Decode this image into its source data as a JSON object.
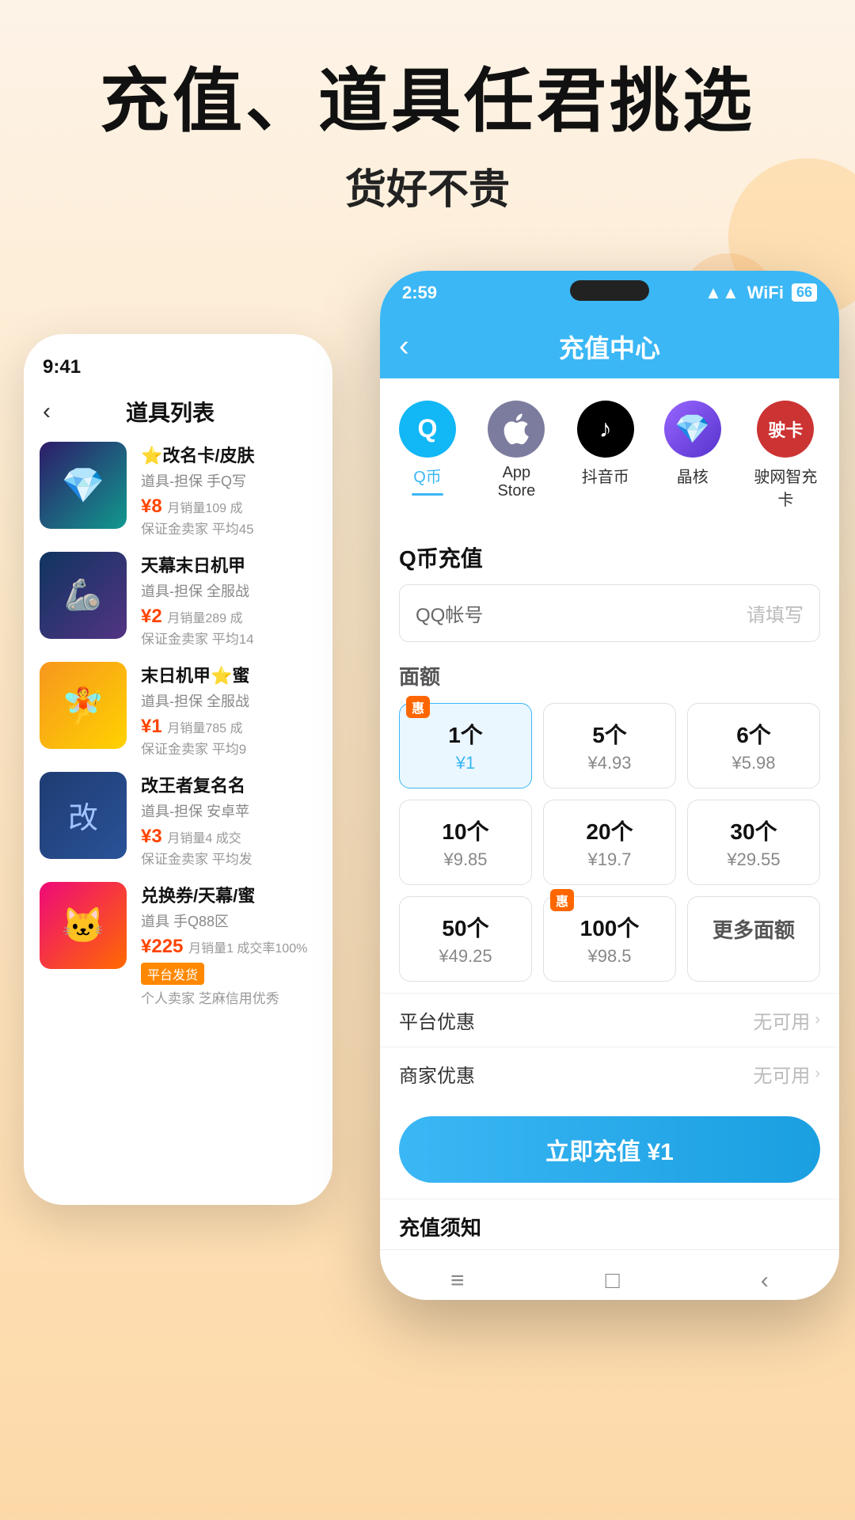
{
  "hero": {
    "title": "充值、道具任君挑选",
    "subtitle": "货好不贵"
  },
  "back_phone": {
    "status_time": "9:41",
    "nav_back": "‹",
    "nav_title": "道具列表",
    "items": [
      {
        "name": "⭐改名卡/皮肤",
        "desc": "道具-担保 手Q写",
        "price": "¥8",
        "sales": "月销量109 成",
        "seller": "保证金卖家 平均45",
        "color": "crystal",
        "emoji": "💎"
      },
      {
        "name": "天幕末日机甲",
        "desc": "道具-担保 全服战",
        "price": "¥2",
        "sales": "月销量289 成",
        "seller": "保证金卖家 平均14",
        "color": "robot",
        "emoji": "🤖"
      },
      {
        "name": "末日机甲⭐蜜",
        "desc": "道具-担保 全服战",
        "price": "¥1",
        "sales": "月销量785 成",
        "seller": "保证金卖家 平均9",
        "color": "angel",
        "emoji": "👼"
      },
      {
        "name": "改王者复名名",
        "desc": "道具-担保 安卓苹",
        "price": "¥3",
        "sales": "月销量4 成交",
        "seller": "保证金卖家 平均发",
        "color": "card",
        "emoji": "🃏"
      },
      {
        "name": "兑换券/天幕/蜜",
        "desc": "道具 手Q88区",
        "price": "¥225",
        "sales": "月销量1 成交率100%",
        "seller": "平台发货",
        "platform": true,
        "seller2": "个人卖家 芝麻信用优秀",
        "color": "kitty",
        "emoji": "🐱"
      }
    ]
  },
  "front_phone": {
    "status_time": "2:59",
    "status_icons": "▲▲ WiFi 66",
    "nav_back": "‹",
    "nav_title": "充值中心",
    "categories": [
      {
        "label": "Q币",
        "icon": "Q",
        "active": true
      },
      {
        "label": "App Store",
        "icon": "🍎",
        "active": false
      },
      {
        "label": "抖音币",
        "icon": "♪",
        "active": false
      },
      {
        "label": "晶核",
        "icon": "💜",
        "active": false
      },
      {
        "label": "驶卡",
        "icon": "驶",
        "active": false
      }
    ],
    "section_title": "Q币充值",
    "account_label": "QQ帐号",
    "account_placeholder": "请填写",
    "denom_title": "面额",
    "denominations": [
      {
        "qty": "1个",
        "price": "¥1",
        "selected": true,
        "badge": "惠"
      },
      {
        "qty": "5个",
        "price": "¥4.93",
        "selected": false,
        "badge": null
      },
      {
        "qty": "6个",
        "price": "¥5.98",
        "selected": false,
        "badge": null
      },
      {
        "qty": "10个",
        "price": "¥9.85",
        "selected": false,
        "badge": null
      },
      {
        "qty": "20个",
        "price": "¥19.7",
        "selected": false,
        "badge": null
      },
      {
        "qty": "30个",
        "price": "¥29.55",
        "selected": false,
        "badge": null
      },
      {
        "qty": "50个",
        "price": "¥49.25",
        "selected": false,
        "badge": null
      },
      {
        "qty": "100个",
        "price": "¥98.5",
        "selected": false,
        "badge": "惠"
      },
      {
        "qty": "更多面额",
        "price": null,
        "selected": false,
        "badge": null,
        "more": true
      }
    ],
    "platform_discount_label": "平台优惠",
    "platform_discount_value": "无可用",
    "merchant_discount_label": "商家优惠",
    "merchant_discount_value": "无可用",
    "charge_btn": "立即充值 ¥1",
    "notice_title": "充值须知",
    "bottom_nav": [
      "≡",
      "□",
      "‹"
    ]
  }
}
